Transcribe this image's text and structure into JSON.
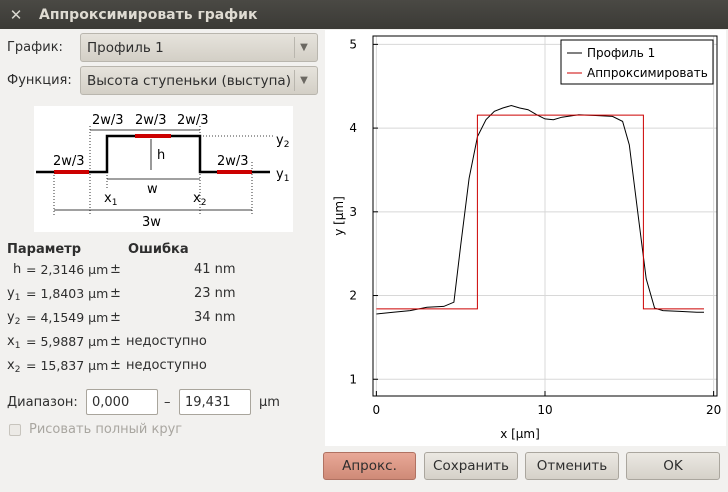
{
  "window": {
    "title": "Аппроксимировать график"
  },
  "graph_row": {
    "label": "График:",
    "value": "Профиль 1"
  },
  "function_row": {
    "label": "Функция:",
    "value": "Высота ступеньки (выступа)"
  },
  "schema": {
    "labels": {
      "seg_left": "2w/3",
      "seg_mid": "2w/3",
      "seg_right": "2w/3",
      "low_left": "2w/3",
      "low_right": "2w/3",
      "h": "h",
      "w": "w",
      "x1": "x",
      "x1_sub": "1",
      "x2": "x",
      "x2_sub": "2",
      "three_w": "3w",
      "y1": "y",
      "y1_sub": "1",
      "y2": "y",
      "y2_sub": "2"
    }
  },
  "params": {
    "header_param": "Параметр",
    "header_error": "Ошибка",
    "rows": [
      {
        "sym": "h",
        "sub": "",
        "value": "= 2,3146 µm",
        "pm": "±",
        "error": "41 nm"
      },
      {
        "sym": "y",
        "sub": "1",
        "value": "= 1,8403 µm",
        "pm": "±",
        "error": "23 nm"
      },
      {
        "sym": "y",
        "sub": "2",
        "value": "= 4,1549 µm",
        "pm": "±",
        "error": "34 nm"
      },
      {
        "sym": "x",
        "sub": "1",
        "value": "= 5,9887 µm",
        "pm": "±",
        "error": "недоступно"
      },
      {
        "sym": "x",
        "sub": "2",
        "value": "= 15,837 µm",
        "pm": "±",
        "error": "недоступно"
      }
    ]
  },
  "range": {
    "label": "Диапазон:",
    "from": "0,000",
    "dash": "–",
    "to": "19,431",
    "unit": "µm"
  },
  "checkbox": {
    "label": "Рисовать полный круг",
    "checked": false
  },
  "buttons": {
    "fit": "Апрокс.",
    "save": "Сохранить",
    "cancel": "Отменить",
    "ok": "OK"
  },
  "chart_data": {
    "type": "line",
    "xlabel": "x [µm]",
    "ylabel": "y [µm]",
    "xlim": [
      -0.2,
      20.2
    ],
    "ylim": [
      0.8,
      5.1
    ],
    "x_ticks": [
      0,
      10,
      20
    ],
    "y_ticks": [
      1,
      2,
      3,
      4,
      5
    ],
    "grid": true,
    "legend": "top-right",
    "series": [
      {
        "name": "Профиль 1",
        "color": "#000000",
        "x": [
          0,
          1,
          2,
          3,
          4,
          4.6,
          5,
          5.5,
          6,
          6.5,
          7,
          7.5,
          8,
          8.5,
          9,
          9.5,
          10,
          10.5,
          11,
          12,
          13,
          14,
          14.6,
          15,
          15.5,
          16,
          16.5,
          17,
          18,
          19,
          19.431
        ],
        "y": [
          1.78,
          1.8,
          1.82,
          1.86,
          1.87,
          1.92,
          2.6,
          3.4,
          3.9,
          4.1,
          4.2,
          4.24,
          4.27,
          4.24,
          4.22,
          4.16,
          4.11,
          4.1,
          4.13,
          4.16,
          4.15,
          4.14,
          4.08,
          3.8,
          3.0,
          2.2,
          1.85,
          1.82,
          1.81,
          1.8,
          1.8
        ]
      },
      {
        "name": "Аппроксимировать",
        "color": "#cc0000",
        "x": [
          0,
          5.9887,
          5.9887,
          15.837,
          15.837,
          19.431
        ],
        "y": [
          1.8403,
          1.8403,
          4.1549,
          4.1549,
          1.8403,
          1.8403
        ]
      }
    ]
  }
}
